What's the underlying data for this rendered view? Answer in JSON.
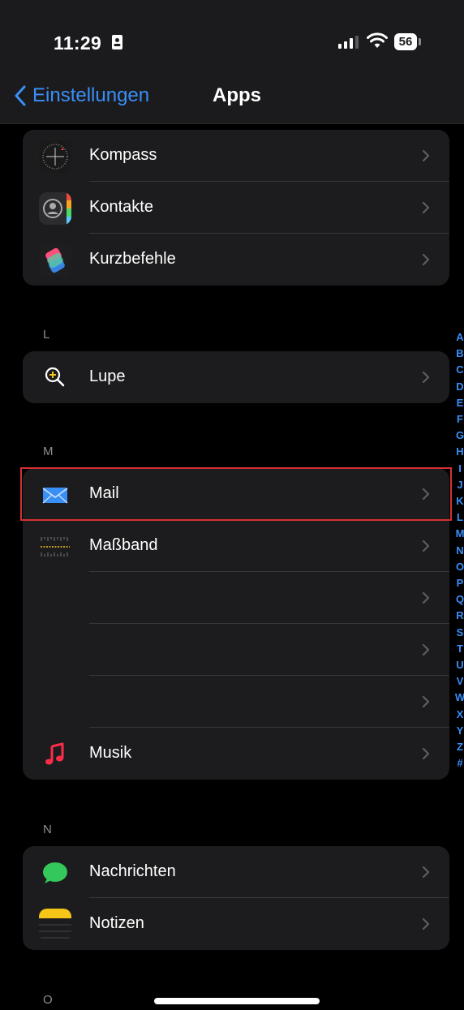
{
  "status_bar": {
    "time": "11:29",
    "battery": "56"
  },
  "nav": {
    "back_label": "Einstellungen",
    "title": "Apps"
  },
  "groups": {
    "k": {
      "items": [
        {
          "label": "Kompass",
          "icon": "compass-icon"
        },
        {
          "label": "Kontakte",
          "icon": "contacts-icon"
        },
        {
          "label": "Kurzbefehle",
          "icon": "shortcuts-icon"
        }
      ]
    },
    "l": {
      "header": "L",
      "items": [
        {
          "label": "Lupe",
          "icon": "magnifier-icon"
        }
      ]
    },
    "m": {
      "header": "M",
      "items": [
        {
          "label": "Mail",
          "icon": "mail-icon"
        },
        {
          "label": "Maßband",
          "icon": "measure-icon"
        },
        {
          "label": "",
          "icon": ""
        },
        {
          "label": "",
          "icon": ""
        },
        {
          "label": "",
          "icon": ""
        },
        {
          "label": "Musik",
          "icon": "music-icon"
        }
      ]
    },
    "n": {
      "header": "N",
      "items": [
        {
          "label": "Nachrichten",
          "icon": "messages-icon"
        },
        {
          "label": "Notizen",
          "icon": "notes-icon"
        }
      ]
    },
    "o": {
      "header": "O"
    }
  },
  "index_letters": [
    "A",
    "B",
    "C",
    "D",
    "E",
    "F",
    "G",
    "H",
    "I",
    "J",
    "K",
    "L",
    "M",
    "N",
    "O",
    "P",
    "Q",
    "R",
    "S",
    "T",
    "U",
    "V",
    "W",
    "X",
    "Y",
    "Z",
    "#"
  ],
  "colors": {
    "accent": "#3a8ff7",
    "highlight": "#d63033",
    "cell": "#1c1c1e"
  }
}
